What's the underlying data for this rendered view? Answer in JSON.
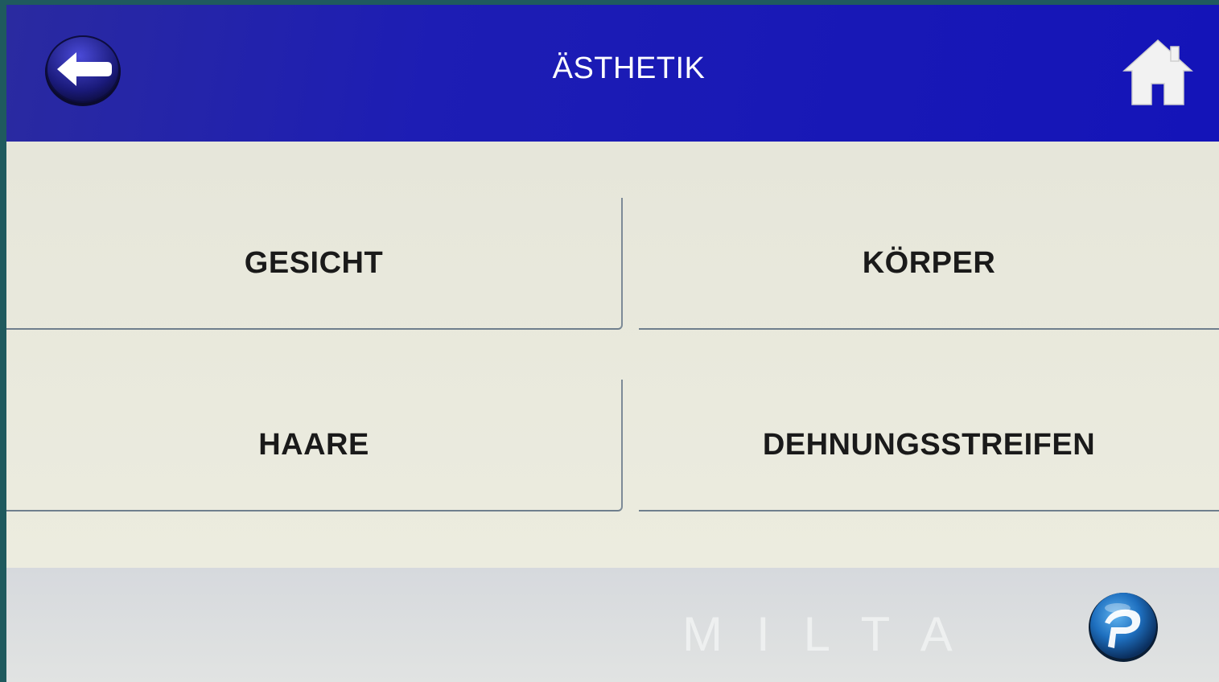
{
  "header": {
    "title": "ÄSTHETIK",
    "back_icon": "back-arrow-icon",
    "home_icon": "home-icon",
    "background_color": "#1414b8"
  },
  "menu": {
    "items": [
      {
        "label": "GESICHT"
      },
      {
        "label": "KÖRPER"
      },
      {
        "label": "HAARE"
      },
      {
        "label": "DEHNUNGSSTREIFEN"
      }
    ]
  },
  "footer": {
    "brand": "MILTA",
    "logo_icon": "app-logo-icon"
  }
}
